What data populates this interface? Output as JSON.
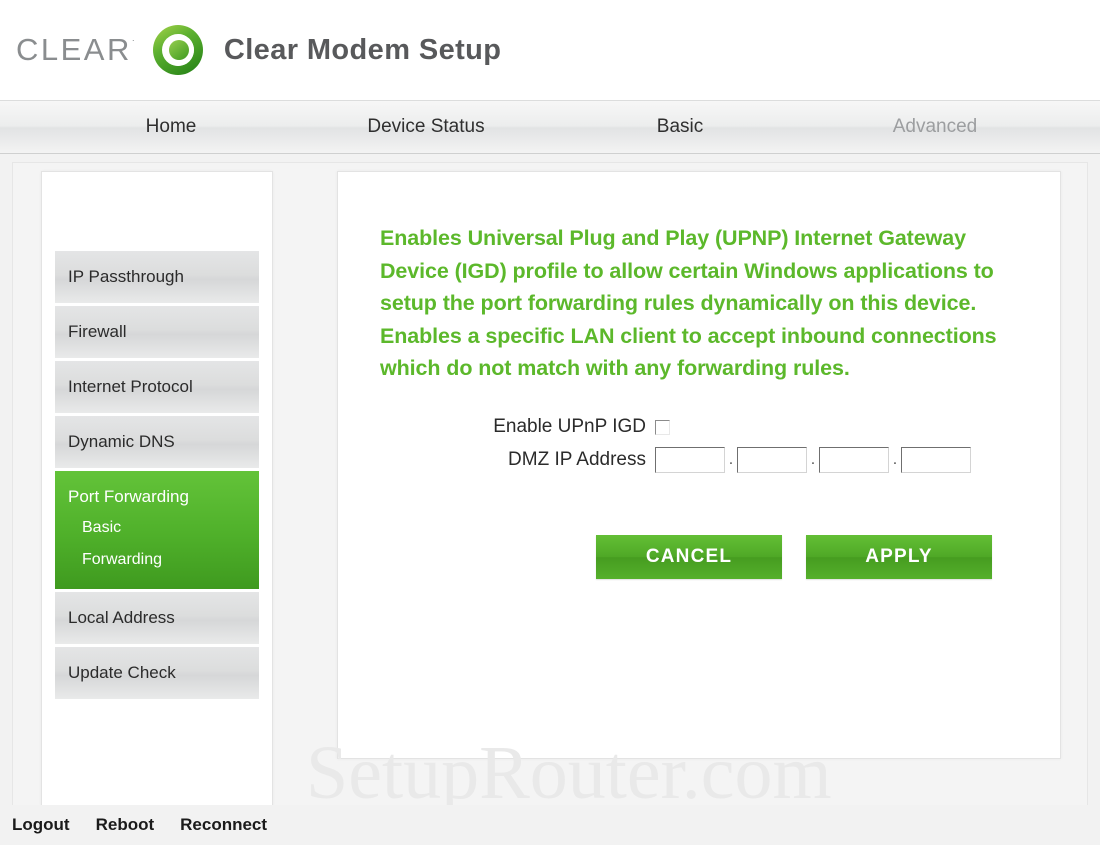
{
  "header": {
    "brand_word": "CLEAR",
    "brand_mark": "˙",
    "title": "Clear Modem Setup",
    "logo_icon": "clear-swirl-logo"
  },
  "nav": {
    "items": [
      {
        "label": "Home",
        "state": "normal"
      },
      {
        "label": "Device Status",
        "state": "normal"
      },
      {
        "label": "Basic",
        "state": "normal"
      },
      {
        "label": "Advanced",
        "state": "active-dim"
      }
    ]
  },
  "sidebar": {
    "items": [
      {
        "label": "IP Passthrough",
        "active": false
      },
      {
        "label": "Firewall",
        "active": false
      },
      {
        "label": "Internet Protocol",
        "active": false
      },
      {
        "label": "Dynamic DNS",
        "active": false
      },
      {
        "label": "Port Forwarding",
        "active": true,
        "sub": [
          "Basic",
          "Forwarding"
        ]
      },
      {
        "label": "Local Address",
        "active": false
      },
      {
        "label": "Update Check",
        "active": false
      }
    ]
  },
  "main": {
    "description": "Enables Universal Plug and Play (UPNP) Internet Gateway Device (IGD) profile to allow certain Windows applications to setup the port forwarding rules dynamically on this device. Enables a specific LAN client to accept inbound connections which do not match with any forwarding rules.",
    "form": {
      "upnp_label": "Enable UPnP IGD",
      "upnp_checked": false,
      "dmz_label": "DMZ IP Address",
      "dmz_octets": [
        "",
        "",
        "",
        ""
      ],
      "dmz_separator": "."
    },
    "buttons": {
      "cancel": "CANCEL",
      "apply": "APPLY"
    }
  },
  "watermark": "SetupRouter.com",
  "footer": {
    "links": [
      "Logout",
      "Reboot",
      "Reconnect"
    ]
  },
  "colors": {
    "brand_green": "#5cb82b",
    "active_green": "#4fb02a",
    "button_green": "#4fa826",
    "nav_dim": "#9c9ea0"
  }
}
